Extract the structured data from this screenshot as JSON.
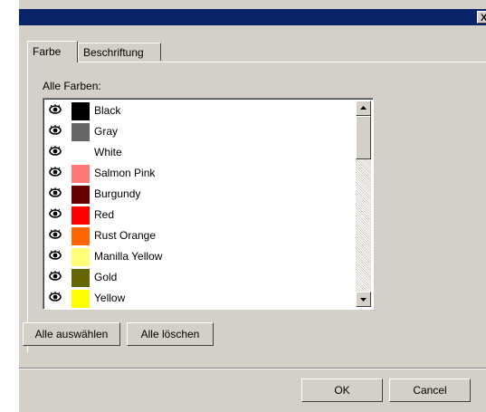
{
  "window": {
    "close_glyph": "X"
  },
  "tabs": [
    {
      "label": "Farbe",
      "active": true
    },
    {
      "label": "Beschriftung",
      "active": false
    }
  ],
  "list_label": "Alle Farben:",
  "colors": [
    {
      "name": "Black",
      "color": "#000000",
      "visible": true
    },
    {
      "name": "Gray",
      "color": "#666666",
      "visible": true
    },
    {
      "name": "White",
      "color": "#ffffff",
      "visible": true
    },
    {
      "name": "Salmon Pink",
      "color": "#ff7777",
      "visible": true
    },
    {
      "name": "Burgundy",
      "color": "#660000",
      "visible": true
    },
    {
      "name": "Red",
      "color": "#ff0000",
      "visible": true
    },
    {
      "name": "Rust Orange",
      "color": "#ff6600",
      "visible": true
    },
    {
      "name": "Manilla Yellow",
      "color": "#ffff77",
      "visible": true
    },
    {
      "name": "Gold",
      "color": "#666600",
      "visible": true
    },
    {
      "name": "Yellow",
      "color": "#ffff00",
      "visible": true
    }
  ],
  "buttons": {
    "select_all": "Alle auswählen",
    "clear_all": "Alle löschen",
    "ok": "OK",
    "cancel": "Cancel"
  },
  "theme": {
    "titlebar": "#0a246a",
    "face": "#d4d0c8"
  }
}
